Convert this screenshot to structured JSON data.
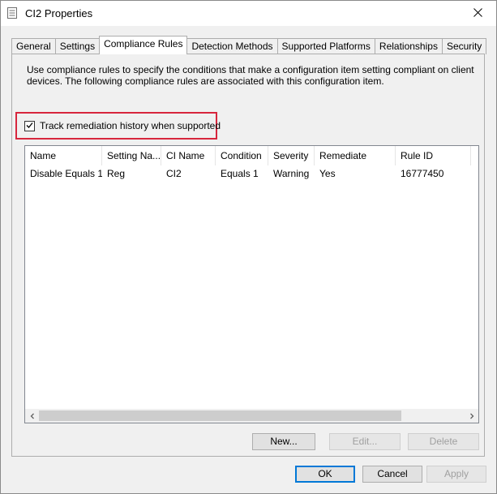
{
  "window": {
    "title": "CI2 Properties"
  },
  "tabs": [
    {
      "label": "General"
    },
    {
      "label": "Settings"
    },
    {
      "label": "Compliance Rules",
      "active": true
    },
    {
      "label": "Detection Methods"
    },
    {
      "label": "Supported Platforms"
    },
    {
      "label": "Relationships"
    },
    {
      "label": "Security"
    }
  ],
  "panel": {
    "description": "Use compliance rules to specify the conditions that make a configuration item setting compliant on client devices. The following compliance rules are associated with this configuration item.",
    "track_label": "Track remediation history when supported",
    "track_checked": true
  },
  "rules_table": {
    "columns": [
      "Name",
      "Setting Na...",
      "CI Name",
      "Condition",
      "Severity",
      "Remediate",
      "Rule ID"
    ],
    "rows": [
      [
        "Disable Equals 1",
        "Reg",
        "CI2",
        "Equals 1",
        "Warning",
        "Yes",
        "16777450"
      ]
    ]
  },
  "list_buttons": {
    "new": "New...",
    "edit": "Edit...",
    "delete": "Delete"
  },
  "dialog_buttons": {
    "ok": "OK",
    "cancel": "Cancel",
    "apply": "Apply"
  },
  "colors": {
    "highlight": "#d7263d",
    "default_button_border": "#0078d7"
  },
  "icons": {
    "title": "properties-sheet-icon",
    "close": "close-icon",
    "check": "checkmark-icon",
    "scroll_left": "chevron-left-icon",
    "scroll_right": "chevron-right-icon"
  }
}
